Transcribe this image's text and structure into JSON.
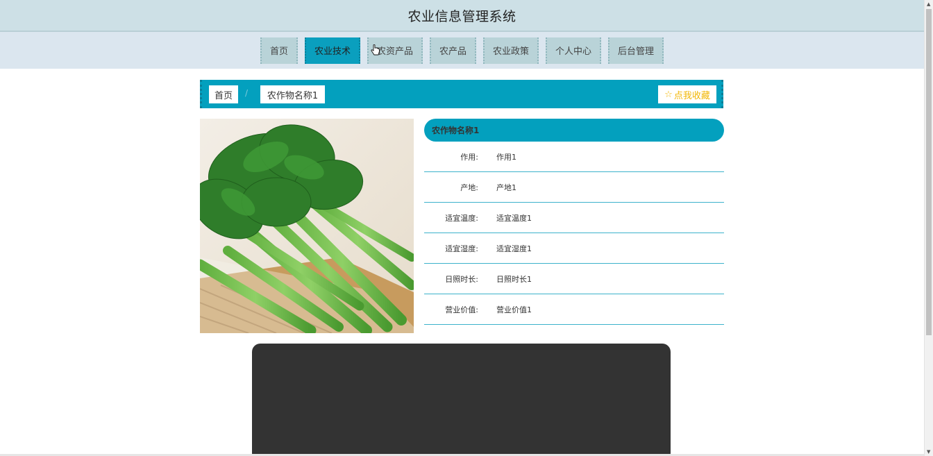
{
  "header": {
    "title": "农业信息管理系统"
  },
  "nav": {
    "items": [
      {
        "label": "首页"
      },
      {
        "label": "农业技术"
      },
      {
        "label": "农资产品"
      },
      {
        "label": "农产品"
      },
      {
        "label": "农业政策"
      },
      {
        "label": "个人中心"
      },
      {
        "label": "后台管理"
      }
    ],
    "active_index": 1
  },
  "breadcrumb": {
    "home": "首页",
    "separator": "/",
    "current": "农作物名称1",
    "favorite_label": "点我收藏",
    "favorite_icon": "star-outline-icon"
  },
  "detail": {
    "title": "农作物名称1",
    "rows": [
      {
        "label": "作用:",
        "value": "作用1"
      },
      {
        "label": "产地:",
        "value": "产地1"
      },
      {
        "label": "适宜温度:",
        "value": "适宜温度1"
      },
      {
        "label": "适宜湿度:",
        "value": "适宜湿度1"
      },
      {
        "label": "日照时长:",
        "value": "日照时长1"
      },
      {
        "label": "营业价值:",
        "value": "营业价值1"
      }
    ]
  },
  "colors": {
    "accent": "#03a0be",
    "header_bg": "#cde0e6",
    "nav_bg": "#dbe6ef",
    "nav_item_bg": "#b9d3d8",
    "favorite_text": "#f2b705",
    "video_bg": "#333333"
  }
}
